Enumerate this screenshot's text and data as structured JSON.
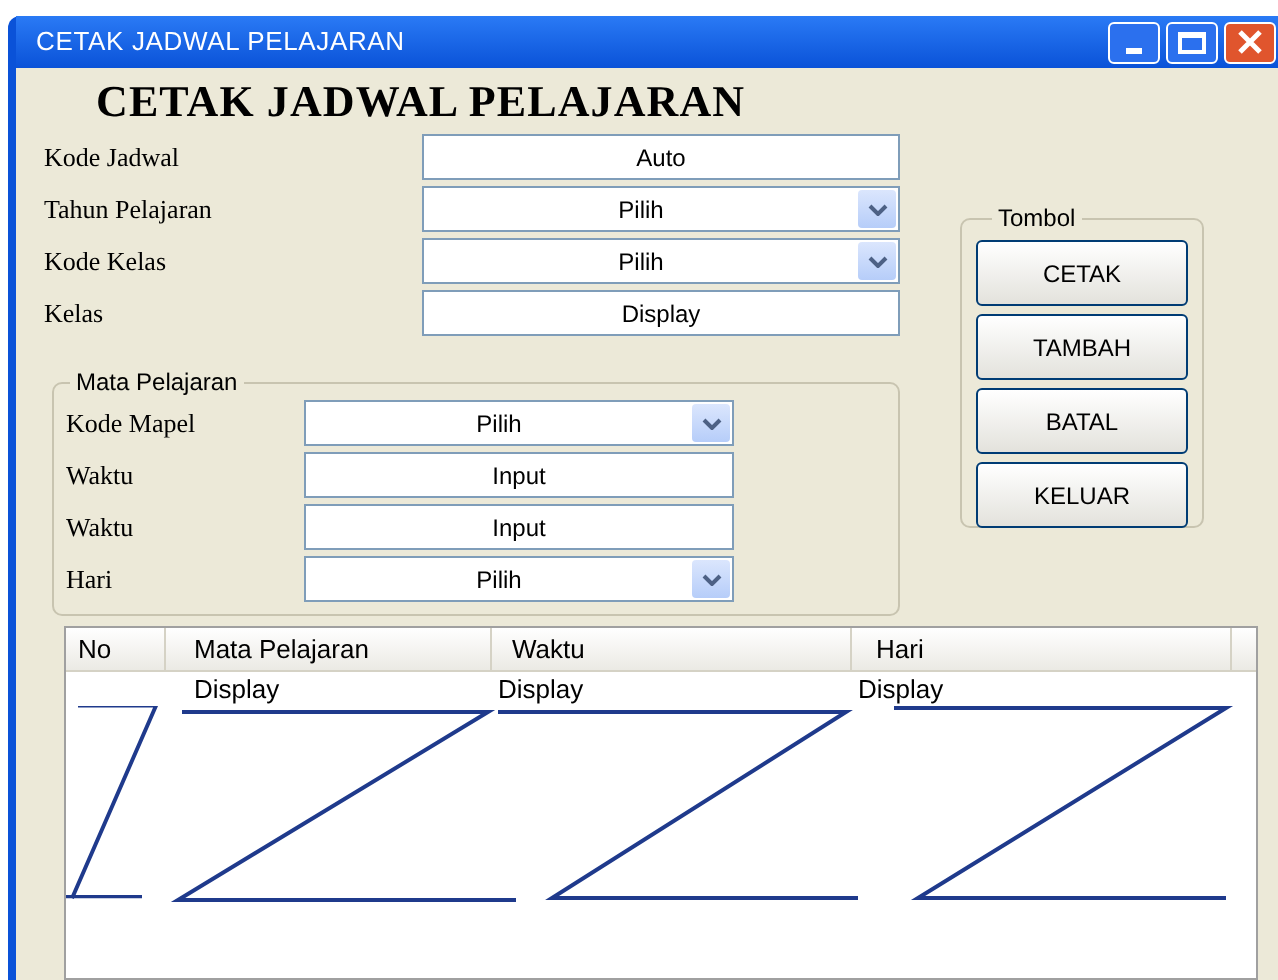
{
  "window": {
    "title": "CETAK JADWAL PELAJARAN"
  },
  "heading": "CETAK JADWAL PELAJARAN",
  "fields": [
    {
      "label": "Kode Jadwal",
      "kind": "text",
      "value": "Auto"
    },
    {
      "label": "Tahun Pelajaran",
      "kind": "combo",
      "value": "Pilih"
    },
    {
      "label": "Kode Kelas",
      "kind": "combo",
      "value": "Pilih"
    },
    {
      "label": "Kelas",
      "kind": "text",
      "value": "Display"
    }
  ],
  "mata_pelajaran": {
    "title": "Mata Pelajaran",
    "fields": [
      {
        "label": "Kode Mapel",
        "kind": "combo",
        "value": "Pilih"
      },
      {
        "label": "Waktu",
        "kind": "text",
        "value": "Input"
      },
      {
        "label": "Waktu",
        "kind": "text",
        "value": "Input"
      },
      {
        "label": "Hari",
        "kind": "combo",
        "value": "Pilih"
      }
    ]
  },
  "tombol": {
    "title": "Tombol",
    "buttons": [
      "CETAK",
      "TAMBAH",
      "BATAL",
      "KELUAR"
    ]
  },
  "table": {
    "columns": [
      "No",
      "Mata Pelajaran",
      "Waktu",
      "Hari"
    ],
    "rows": [
      {
        "mata_pelajaran": "Display",
        "waktu": "Display",
        "hari": "Display"
      }
    ]
  }
}
